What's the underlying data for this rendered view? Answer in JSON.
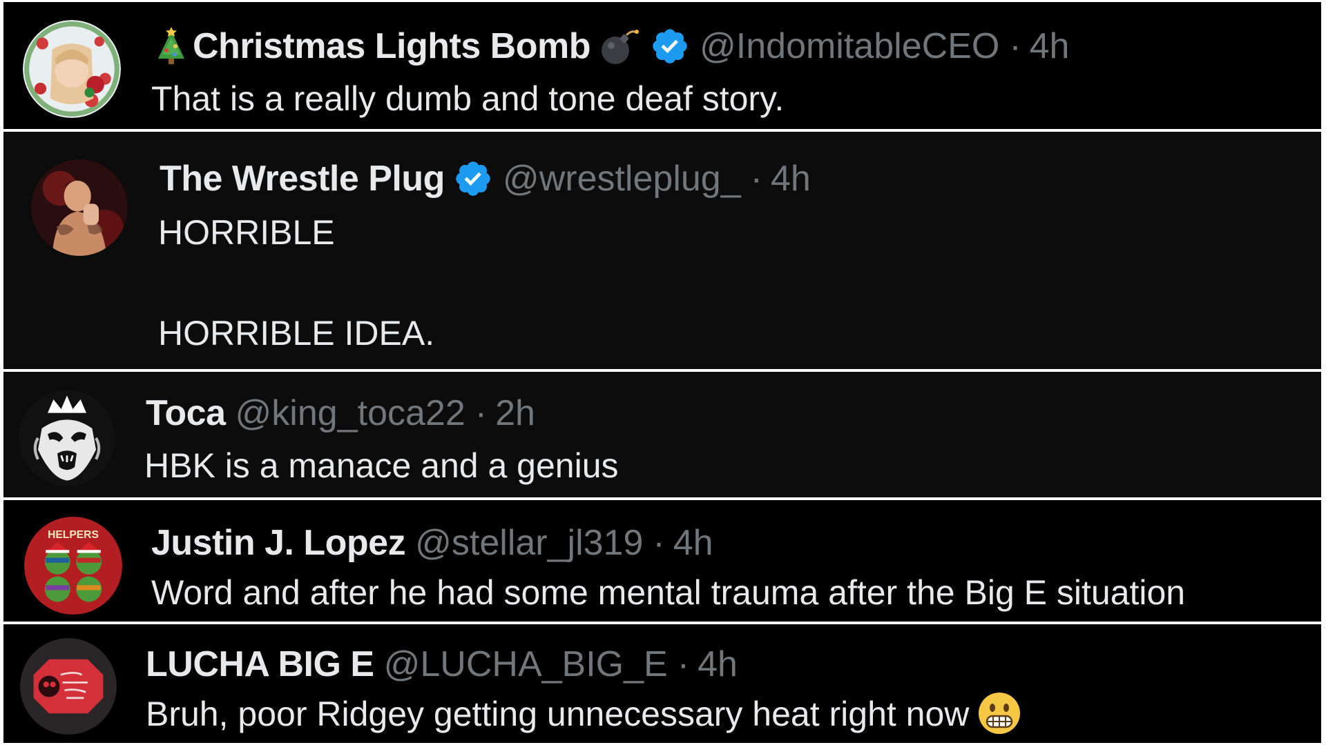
{
  "tweets": [
    {
      "name": "Christmas Lights Bomb",
      "name_prefix_icon": "christmas-tree-icon",
      "name_suffix_icon": "bomb-icon",
      "verified": true,
      "handle": "@IndomitableCEO",
      "separator": "·",
      "time": "4h",
      "lines": [
        "That is a really dumb and tone deaf story."
      ]
    },
    {
      "name": "The Wrestle Plug",
      "verified": true,
      "handle": "@wrestleplug_",
      "separator": "·",
      "time": "4h",
      "lines": [
        "HORRIBLE",
        "HORRIBLE IDEA."
      ]
    },
    {
      "name": "Toca",
      "verified": false,
      "handle": "@king_toca22",
      "separator": "·",
      "time": "2h",
      "lines": [
        "HBK is a manace and a genius"
      ]
    },
    {
      "name": "Justin J. Lopez",
      "verified": false,
      "handle": "@stellar_jl319",
      "separator": "·",
      "time": "4h",
      "avatar_text": "HELPERS",
      "lines": [
        "Word and after he had some mental trauma after the Big E situation"
      ]
    },
    {
      "name": "LUCHA BIG E",
      "verified": false,
      "handle": "@LUCHA_BIG_E",
      "separator": "·",
      "time": "4h",
      "lines": [
        "Bruh, poor Ridgey getting unnecessary heat right now"
      ],
      "trailing_emoji": "grimacing-face-icon"
    }
  ],
  "colors": {
    "background": "#000000",
    "alt_background": "#0c0c0d",
    "name_text": "#e7e9ea",
    "muted_text": "#71767b",
    "verified_blue": "#1d9bf0",
    "divider": "#ffffff"
  }
}
